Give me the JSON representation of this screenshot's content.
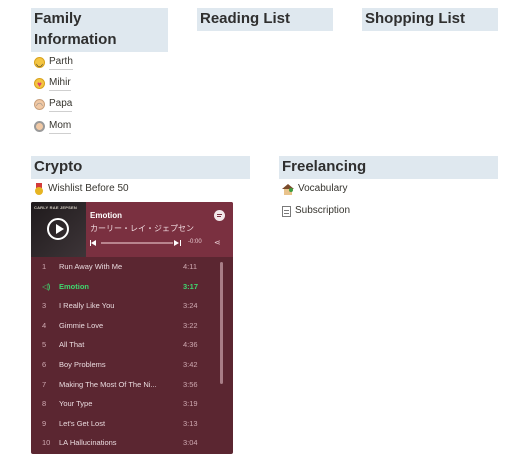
{
  "sections": {
    "family": {
      "title": "Family Information",
      "items": [
        "Parth",
        "Mihir",
        "Papa",
        "Mom"
      ]
    },
    "reading": {
      "title": "Reading List"
    },
    "shopping": {
      "title": "Shopping List"
    },
    "crypto": {
      "title": "Crypto",
      "items": [
        "Wishlist Before 50"
      ]
    },
    "freelancing": {
      "title": "Freelancing",
      "items": [
        "Vocabulary",
        "Subscription"
      ]
    }
  },
  "icons": {
    "family": [
      "smiling-face-icon",
      "kissing-face-icon",
      "grandpa-face-icon",
      "grandma-face-icon"
    ],
    "crypto": [
      "medal-icon"
    ],
    "freelancing": [
      "house-icon",
      "document-icon"
    ]
  },
  "spotify": {
    "cover_text": "CARLY RAE JEPSEN",
    "title": "Emotion",
    "artist": "カーリー・レイ・ジェプセン",
    "time": "-0:00",
    "share_glyph": "⋖",
    "progress": 0,
    "colors": {
      "background": "#5b2631",
      "header": "#7a3040",
      "active": "#3fd66d"
    },
    "active_indicator": "◁)",
    "tracks": [
      {
        "num": "1",
        "name": "Run Away With Me",
        "dur": "4:11"
      },
      {
        "num": "◁)",
        "name": "Emotion",
        "dur": "3:17",
        "active": true
      },
      {
        "num": "3",
        "name": "I Really Like You",
        "dur": "3:24"
      },
      {
        "num": "4",
        "name": "Gimmie Love",
        "dur": "3:22"
      },
      {
        "num": "5",
        "name": "All That",
        "dur": "4:36"
      },
      {
        "num": "6",
        "name": "Boy Problems",
        "dur": "3:42"
      },
      {
        "num": "7",
        "name": "Making The Most Of The Ni...",
        "dur": "3:56"
      },
      {
        "num": "8",
        "name": "Your Type",
        "dur": "3:19"
      },
      {
        "num": "9",
        "name": "Let's Get Lost",
        "dur": "3:13"
      },
      {
        "num": "10",
        "name": "LA Hallucinations",
        "dur": "3:04"
      }
    ]
  }
}
